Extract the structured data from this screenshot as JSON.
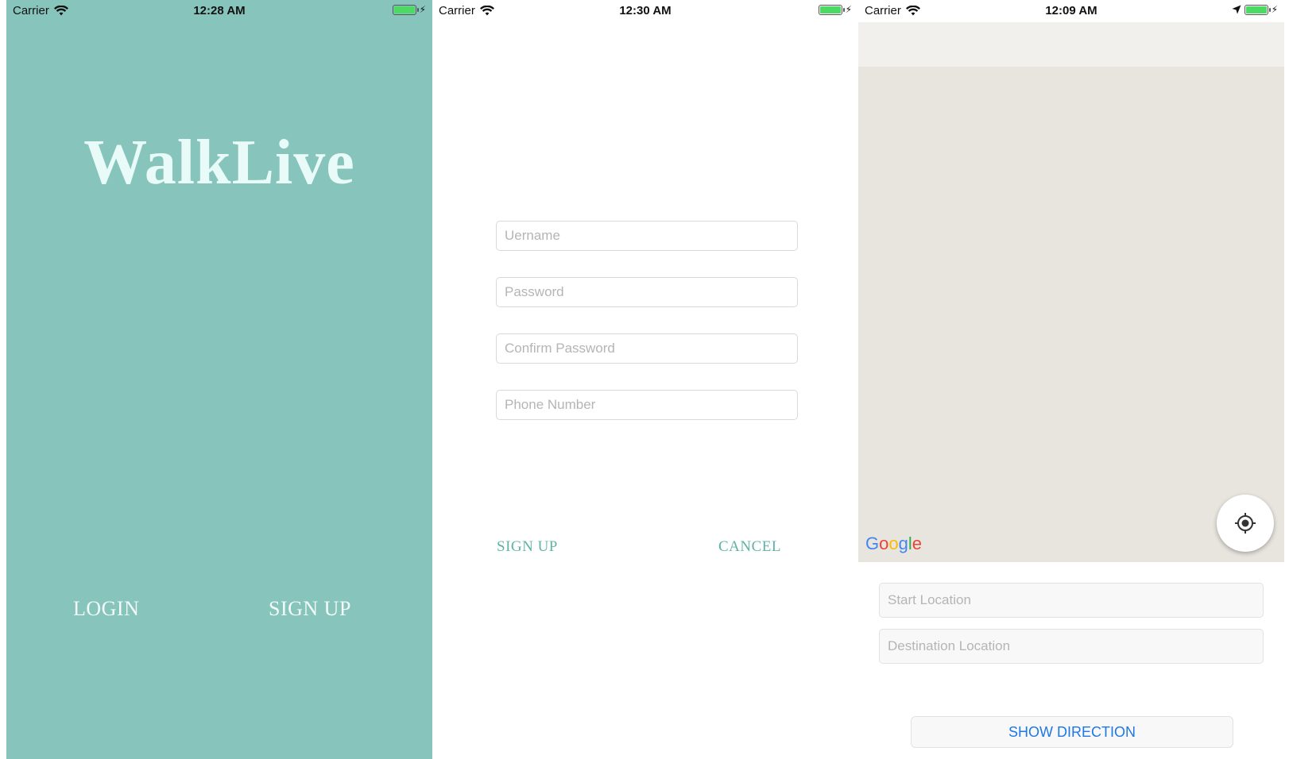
{
  "screens": [
    {
      "status": {
        "carrier": "Carrier",
        "time": "12:28 AM"
      },
      "app_title": "WalkLive",
      "login_label": "LOGIN",
      "signup_label": "SIGN UP"
    },
    {
      "status": {
        "carrier": "Carrier",
        "time": "12:30 AM"
      },
      "fields": {
        "username_placeholder": "Uername",
        "password_placeholder": "Password",
        "confirm_placeholder": "Confirm Password",
        "phone_placeholder": "Phone Number"
      },
      "signup_label": "SIGN UP",
      "cancel_label": "CANCEL"
    },
    {
      "status": {
        "carrier": "Carrier",
        "time": "12:09 AM"
      },
      "map": {
        "provider_logo": "Google"
      },
      "start_placeholder": "Start Location",
      "destination_placeholder": "Destination Location",
      "show_direction_label": "SHOW DIRECTION"
    }
  ],
  "icons": [
    "wifi-icon",
    "battery-icon",
    "charging-bolt-icon",
    "location-arrow-icon",
    "my-location-icon"
  ],
  "colors": {
    "teal_background": "#87c5bc",
    "teal_link": "#5fb3a6",
    "title_text": "#e9fbf8",
    "map_background": "#e8e5df",
    "button_blue": "#1e78e6",
    "battery_green": "#4cd964"
  }
}
